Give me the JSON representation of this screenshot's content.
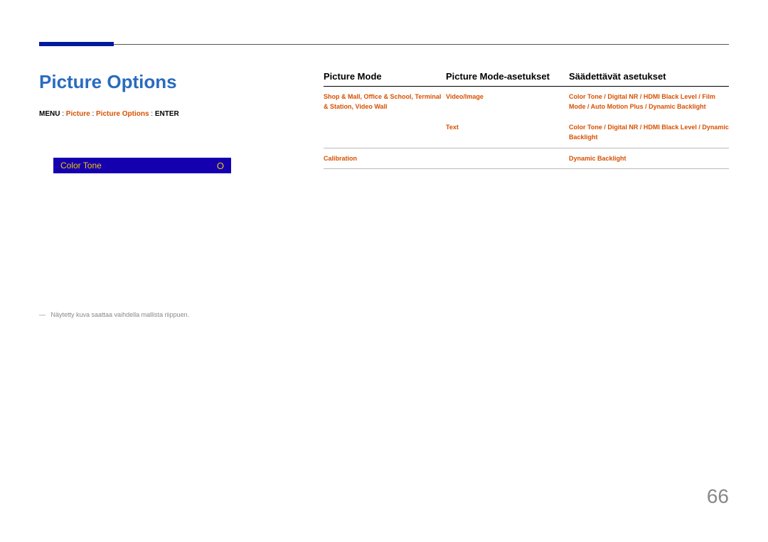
{
  "title": "Picture Options",
  "breadcrumb": {
    "menu": "MENU",
    "sep": ":",
    "item1": "Picture",
    "item2": "Picture Options",
    "enter": "ENTER"
  },
  "menuBox": {
    "label": "Color Tone",
    "value": "O"
  },
  "footnote": "Näytetty kuva saattaa vaihdella mallista riippuen.",
  "table": {
    "headers": [
      "Picture Mode",
      "Picture Mode-asetukset",
      "Säädettävät asetukset"
    ],
    "rows": [
      {
        "c1": "Shop & Mall, Office & School, Terminal & Station, Video Wall",
        "c2": "Video/Image",
        "c3": "Color Tone / Digital NR / HDMI Black Level / Film Mode / Auto Motion Plus / Dynamic Backlight"
      },
      {
        "c1": "",
        "c2": "Text",
        "c3": "Color Tone / Digital NR / HDMI Black Level / Dynamic Backlight"
      },
      {
        "c1": "Calibration",
        "c2": "",
        "c3": "Dynamic Backlight"
      }
    ]
  },
  "pageNumber": "66"
}
